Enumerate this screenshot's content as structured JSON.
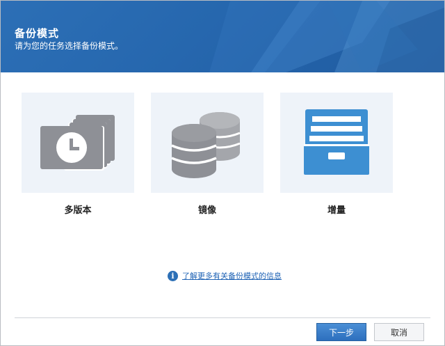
{
  "header": {
    "title": "备份模式",
    "subtitle": "请为您的任务选择备份模式。"
  },
  "modes": [
    {
      "label": "多版本",
      "icon": "multi-version-icon"
    },
    {
      "label": "镜像",
      "icon": "database-mirror-icon"
    },
    {
      "label": "增量",
      "icon": "file-drawer-icon"
    }
  ],
  "info": {
    "icon": "info-icon",
    "link_text": "了解更多有关备份模式的信息"
  },
  "footer": {
    "next_label": "下一步",
    "cancel_label": "取消"
  },
  "colors": {
    "header_blue": "#2667ae",
    "card_bg": "#eef3f9",
    "icon_gray": "#8e9096",
    "drawer_blue": "#3d8fd2",
    "link_blue": "#1f63b5"
  }
}
